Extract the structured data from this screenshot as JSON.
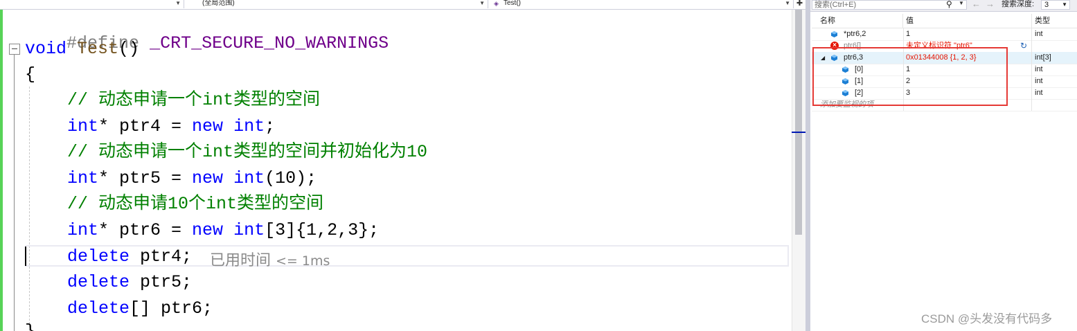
{
  "nav": {
    "scope_label": "",
    "file_label": "(全局范围)",
    "function_label": "Test()",
    "split_icon": "split-icon"
  },
  "code": {
    "line1": {
      "directive": "#define",
      "macro": "_CRT_SECURE_NO_WARNINGS"
    },
    "line2": {
      "kw": "void",
      "fn": "Test",
      "rest": "()"
    },
    "line3": {
      "text": "{"
    },
    "line4": {
      "comment": "// 动态申请一个int类型的空间"
    },
    "line5": {
      "kw1": "int",
      "mid1": "* ptr4 = ",
      "kw2": "new",
      "sp": " ",
      "kw3": "int",
      "end": ";"
    },
    "line6": {
      "comment": "// 动态申请一个int类型的空间并初始化为10"
    },
    "line7": {
      "kw1": "int",
      "mid1": "* ptr5 = ",
      "kw2": "new",
      "sp": " ",
      "kw3": "int",
      "end": "(10);"
    },
    "line8": {
      "comment": "// 动态申请10个int类型的空间"
    },
    "line9": {
      "kw1": "int",
      "mid1": "* ptr6 = ",
      "kw2": "new",
      "sp": " ",
      "kw3": "int",
      "end": "[3]{1,2,3};"
    },
    "line10": {
      "kw": "delete",
      "rest": " ptr4;"
    },
    "line11": {
      "kw": "delete",
      "rest": " ptr5;"
    },
    "line12": {
      "kw": "delete",
      "rest": "[] ptr6;"
    },
    "line13": {
      "text": "}"
    },
    "perf_tip_main": "已用时间",
    "perf_tip_small": "<= 1ms"
  },
  "watch": {
    "search_placeholder": "搜索(Ctrl+E)",
    "search_icon": "search-icon",
    "depth_label": "搜索深度:",
    "depth_value": "3",
    "columns": {
      "name": "名称",
      "value": "值",
      "type": "类型"
    },
    "rows": [
      {
        "name": "*ptr6,2",
        "value": "1",
        "type": "int",
        "icon": "variable-cube-icon"
      },
      {
        "name": "ptr6[]",
        "value": "未定义标识符 \"ptr6\"",
        "type": "",
        "icon": "error-icon",
        "error": true
      },
      {
        "name": "ptr6,3",
        "value": "0x01344008 {1, 2, 3}",
        "type": "int[3]",
        "icon": "variable-cube-icon",
        "expanded": true,
        "changed": true
      },
      {
        "name": "[0]",
        "value": "1",
        "type": "int",
        "icon": "variable-cube-icon"
      },
      {
        "name": "[1]",
        "value": "2",
        "type": "int",
        "icon": "variable-cube-icon"
      },
      {
        "name": "[2]",
        "value": "3",
        "type": "int",
        "icon": "variable-cube-icon"
      }
    ],
    "add_watch_placeholder": "添加要监视的项"
  },
  "watermark": "CSDN @头发没有代码多",
  "colors": {
    "keyword": "#0000ff",
    "comment": "#008000",
    "macro": "#6f008a",
    "error": "#e51400",
    "highlight_box": "#e53935",
    "change_margin": "#57d357"
  }
}
